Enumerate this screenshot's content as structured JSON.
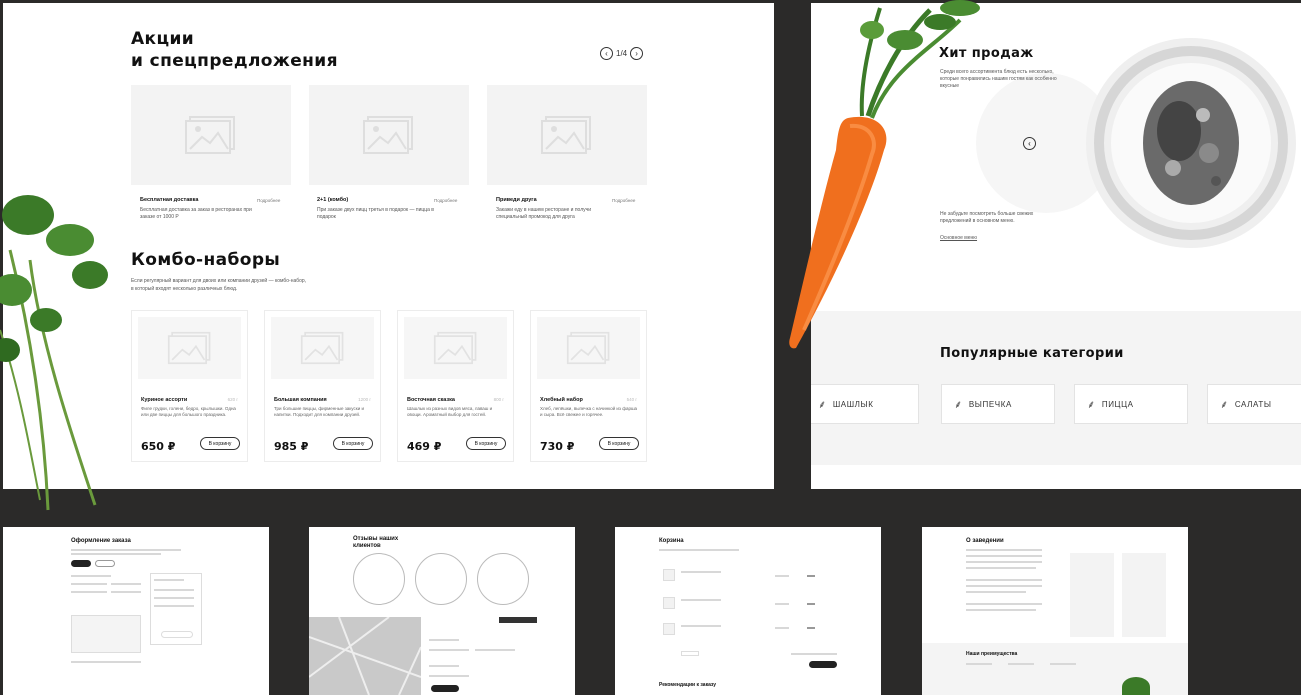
{
  "panel_a": {
    "promo_title_line1": "Акции",
    "promo_title_line2": "и спецпредложения",
    "pager": "1/4",
    "promos": [
      {
        "name": "Бесплатная доставка",
        "tag": "Подробнее",
        "desc": "Бесплатная доставка за заказ в ресторанах при заказе от 1000 Р"
      },
      {
        "name": "2+1 (комбо)",
        "tag": "Подробнее",
        "desc": "При заказе двух пицц третья в подарок — пицца в подарок"
      },
      {
        "name": "Приведи друга",
        "tag": "Подробнее",
        "desc": "Закажи еду в нашем ресторане и получи специальный промокод для друга"
      }
    ],
    "combo_title": "Комбо-наборы",
    "combo_desc_line1": "Если регулярный вариант для двоих или компании друзей — комбо-набор,",
    "combo_desc_line2": "в который входят несколько различных блюд.",
    "combos": [
      {
        "name": "Куриное ассорти",
        "weight": "620 г",
        "desc": "Филе грудки, голени, бедро, крылышки. Одна или две пиццы для большого праздника.",
        "price": "650 ₽",
        "button": "В корзину"
      },
      {
        "name": "Большая компания",
        "weight": "1200 г",
        "desc": "Три большие пиццы, фирменные закуски и напитки. Подходит для компании друзей.",
        "price": "985 ₽",
        "button": "В корзину"
      },
      {
        "name": "Восточная сказка",
        "weight": "800 г",
        "desc": "Шашлык из разных видов мяса, лаваш и овощи. Ароматный выбор для гостей.",
        "price": "469 ₽",
        "button": "В корзину"
      },
      {
        "name": "Хлебный набор",
        "weight": "540 г",
        "desc": "Хлеб, лепёшки, выпечка с начинкой из фарша и сыра. Всё свежее и горячее.",
        "price": "730 ₽",
        "button": "В корзину"
      }
    ]
  },
  "panel_b": {
    "hit_title": "Хит продаж",
    "hit_desc": "Среди всего ассортимента блюд есть несколько, которые понравились нашим гостям как особенно вкусные",
    "hit_note": "Не забудьте посмотреть больше свежих предложений в основном меню.",
    "hit_link": "Основное меню",
    "categories_title": "Популярные категории",
    "categories": [
      {
        "label": "ШАШЛЫК",
        "icon": "leaf-icon"
      },
      {
        "label": "ВЫПЕЧКА",
        "icon": "leaf-icon"
      },
      {
        "label": "ПИЦЦА",
        "icon": "leaf-icon"
      },
      {
        "label": "САЛАТЫ",
        "icon": "leaf-icon"
      }
    ]
  },
  "thumbs": {
    "checkout_title": "Оформление заказа",
    "feedback_title": "Отзывы наших клиентов",
    "cart_title": "Корзина",
    "cart_recs": "Рекомендации к заказу",
    "about_title": "О заведении",
    "about_adv": "Наши преимущества"
  },
  "colors": {
    "background": "#2b2a29",
    "panel": "#ffffff",
    "placeholder": "#f3f3f3",
    "carrot": "#f06f1e",
    "herb": "#3b7a28"
  }
}
